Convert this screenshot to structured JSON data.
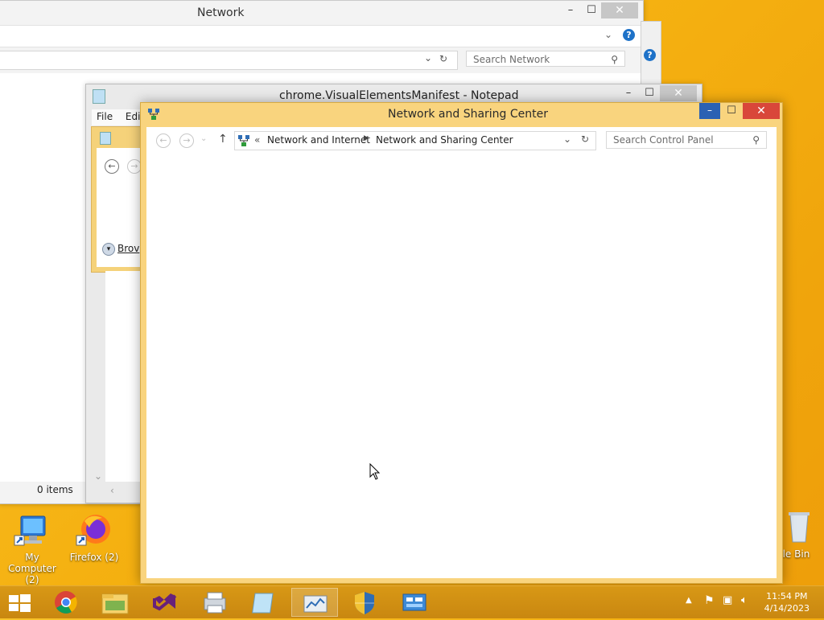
{
  "desktop": {
    "icons": [
      {
        "label": "My Computer (2)"
      },
      {
        "label": "Firefox (2)"
      },
      {
        "label": "cle Bin"
      }
    ]
  },
  "network_window": {
    "title": "Network",
    "search_placeholder": "Search Network",
    "status_text": "0 items"
  },
  "notepad_window": {
    "title": "chrome.VisualElementsManifest - Notepad",
    "menu": [
      "File",
      "Edit"
    ],
    "partial_label": "Brov"
  },
  "nsc_window": {
    "title": "Network and Sharing Center",
    "breadcrumb_overflow": "«",
    "breadcrumb": [
      "Network and Internet",
      "Network and Sharing Center"
    ],
    "search_placeholder": "Search Control Panel"
  },
  "taskbar": {
    "items": [
      "start",
      "chrome",
      "file-explorer",
      "visual-studio",
      "printer",
      "notepad",
      "performance-monitor",
      "security-shield",
      "control-panel"
    ],
    "active_index": 6,
    "time": "11:54 PM",
    "date": "4/14/2023"
  },
  "colors": {
    "accent_yellow": "#f9d47e",
    "help_blue": "#1e72c8",
    "close_red": "#d9473a",
    "taskbar": "#c98710"
  }
}
